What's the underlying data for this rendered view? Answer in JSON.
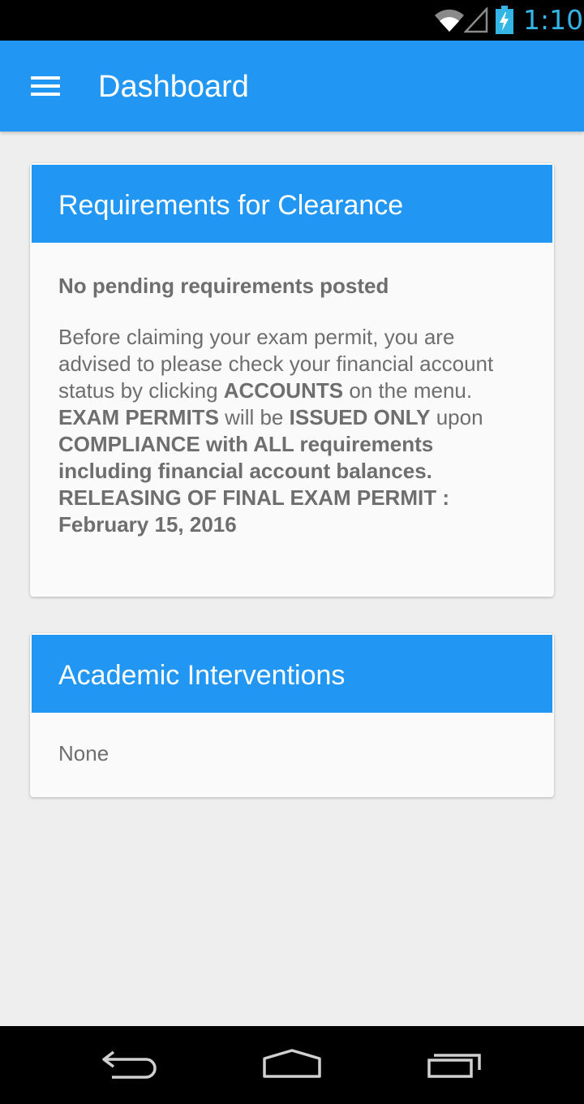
{
  "status_bar": {
    "time": "1:10",
    "icons": [
      "wifi-icon",
      "signal-icon",
      "battery-charging-icon"
    ],
    "icon_color": "#33B5E5"
  },
  "app_bar": {
    "menu_icon": "hamburger-menu-icon",
    "title": "Dashboard",
    "color": "#2196F3"
  },
  "clearance_card": {
    "title": "Requirements for Clearance",
    "subtitle": "No pending requirements posted",
    "segments": [
      {
        "text": "Before claiming your exam permit, you are advised to please check your financial account status by clicking ",
        "bold": false
      },
      {
        "text": "ACCOUNTS",
        "bold": true
      },
      {
        "text": " on the menu. ",
        "bold": false
      },
      {
        "text": "EXAM PERMITS",
        "bold": true
      },
      {
        "text": " will be ",
        "bold": false
      },
      {
        "text": "ISSUED ONLY",
        "bold": true
      },
      {
        "text": " upon ",
        "bold": false
      },
      {
        "text": "COMPLIANCE with ALL requirements including financial account balances.",
        "bold": true
      },
      {
        "text": " ",
        "bold": false
      },
      {
        "text": "RELEASING OF FINAL EXAM PERMIT : February 15, 2016",
        "bold": true
      }
    ]
  },
  "interventions_card": {
    "title": "Academic Interventions",
    "content": "None"
  },
  "nav_bar": {
    "buttons": [
      "back-icon",
      "home-icon",
      "recent-apps-icon"
    ]
  }
}
